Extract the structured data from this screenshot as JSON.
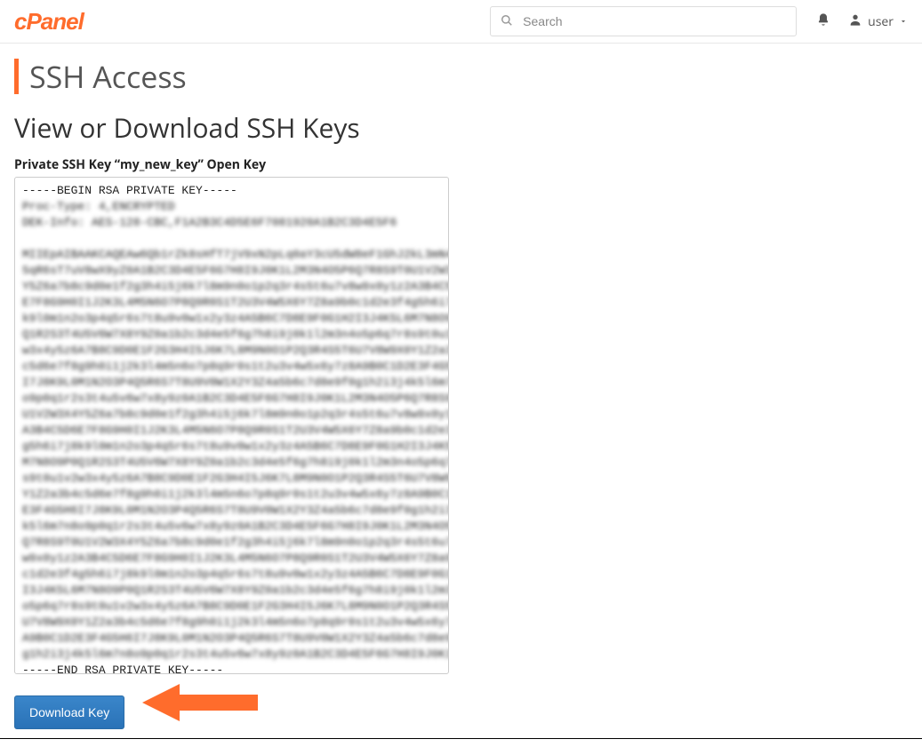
{
  "header": {
    "logo_text": "cPanel",
    "search_placeholder": "Search",
    "user_label": "user"
  },
  "page": {
    "title": "SSH Access",
    "section_title": "View or Download SSH Keys",
    "key_label": "Private SSH Key “my_new_key” Open Key",
    "key_begin": "-----BEGIN RSA PRIVATE KEY-----",
    "key_end": "-----END RSA PRIVATE KEY-----",
    "download_label": "Download Key"
  },
  "key_blur_lines": [
    "Proc-Type: 4,ENCRYPTED",
    "DEK-Info: AES-128-CBC,F1A2B3C4D5E6F7081920A1B2C3D4E5F6",
    "",
    "MIIEpAIBAAKCAQEAw6Qb1rZk8sHfT7jV9xN2pLq0aY3cU5dW8eF1GhJ2kL3mN4oP",
    "5qR6sT7uV8wX9yZ0A1B2C3D4E5F6G7H8I9J0K1L2M3N4O5P6Q7R8S9T0U1V2W3X4",
    "Y5Z6a7b8c9d0e1f2g3h4i5j6k7l8m9n0o1p2q3r4s5t6u7v8w9x0y1z2A3B4C5D6",
    "E7F8G9H0I1J2K3L4M5N6O7P8Q9R0S1T2U3V4W5X6Y7Z8a9b0c1d2e3f4g5h6i7j8",
    "k9l0m1n2o3p4q5r6s7t8u9v0w1x2y3z4A5B6C7D8E9F0G1H2I3J4K5L6M7N8O9P0",
    "Q1R2S3T4U5V6W7X8Y9Z0a1b2c3d4e5f6g7h8i9j0k1l2m3n4o5p6q7r8s9t0u1v2",
    "w3x4y5z6A7B8C9D0E1F2G3H4I5J6K7L8M9N0O1P2Q3R4S5T6U7V8W9X0Y1Z2a3b4",
    "c5d6e7f8g9h0i1j2k3l4m5n6o7p8q9r0s1t2u3v4w5x6y7z8A9B0C1D2E3F4G5H6",
    "I7J8K9L0M1N2O3P4Q5R6S7T8U9V0W1X2Y3Z4a5b6c7d8e9f0g1h2i3j4k5l6m7n8",
    "o9p0q1r2s3t4u5v6w7x8y9z0A1B2C3D4E5F6G7H8I9J0K1L2M3N4O5P6Q7R8S9T0",
    "U1V2W3X4Y5Z6a7b8c9d0e1f2g3h4i5j6k7l8m9n0o1p2q3r4s5t6u7v8w9x0y1z2",
    "A3B4C5D6E7F8G9H0I1J2K3L4M5N6O7P8Q9R0S1T2U3V4W5X6Y7Z8a9b0c1d2e3f4",
    "g5h6i7j8k9l0m1n2o3p4q5r6s7t8u9v0w1x2y3z4A5B6C7D8E9F0G1H2I3J4K5L6",
    "M7N8O9P0Q1R2S3T4U5V6W7X8Y9Z0a1b2c3d4e5f6g7h8i9j0k1l2m3n4o5p6q7r8",
    "s9t0u1v2w3x4y5z6A7B8C9D0E1F2G3H4I5J6K7L8M9N0O1P2Q3R4S5T6U7V8W9X0",
    "Y1Z2a3b4c5d6e7f8g9h0i1j2k3l4m5n6o7p8q9r0s1t2u3v4w5x6y7z8A9B0C1D2",
    "E3F4G5H6I7J8K9L0M1N2O3P4Q5R6S7T8U9V0W1X2Y3Z4a5b6c7d8e9f0g1h2i3j4",
    "k5l6m7n8o9p0q1r2s3t4u5v6w7x8y9z0A1B2C3D4E5F6G7H8I9J0K1L2M3N4O5P6",
    "Q7R8S9T0U1V2W3X4Y5Z6a7b8c9d0e1f2g3h4i5j6k7l8m9n0o1p2q3r4s5t6u7v8",
    "w9x0y1z2A3B4C5D6E7F8G9H0I1J2K3L4M5N6O7P8Q9R0S1T2U3V4W5X6Y7Z8a9b0",
    "c1d2e3f4g5h6i7j8k9l0m1n2o3p4q5r6s7t8u9v0w1x2y3z4A5B6C7D8E9F0G1H2",
    "I3J4K5L6M7N8O9P0Q1R2S3T4U5V6W7X8Y9Z0a1b2c3d4e5f6g7h8i9j0k1l2m3n4",
    "o5p6q7r8s9t0u1v2w3x4y5z6A7B8C9D0E1F2G3H4I5J6K7L8M9N0O1P2Q3R4S5T6",
    "U7V8W9X0Y1Z2a3b4c5d6e7f8g9h0i1j2k3l4m5n6o7p8q9r0s1t2u3v4w5x6y7z8",
    "A9B0C1D2E3F4G5H6I7J8K9L0M1N2O3P4Q5R6S7T8U9V0W1X2Y3Z4a5b6c7d8e9f0",
    "g1h2i3j4k5l6m7n8o9p0q1r2s3t4u5v6w7x8y9z0A1B2C3D4E5F6G7H8I9J0K1=="
  ],
  "colors": {
    "accent": "#ff6c2c",
    "primary_button": "#2f7bbf"
  }
}
